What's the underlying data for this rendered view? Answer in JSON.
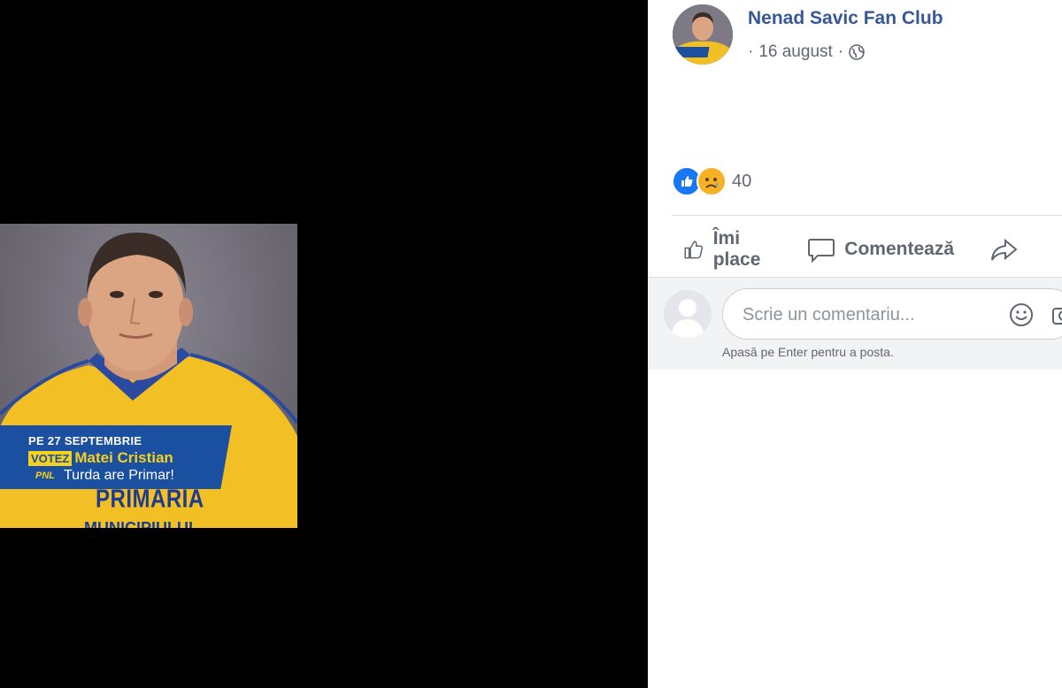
{
  "photo": {
    "banner_line1": "PE 27 SEPTEMBRIE",
    "banner_votez": "VOTEZ",
    "banner_name": "Matei Cristian",
    "banner_party": "PNL",
    "banner_line3": "Turda are Primar!",
    "shirt_text": "PRIMARIA",
    "shirt_text2": "MUNICIPIULUI"
  },
  "post": {
    "page_name": "Nenad Savic Fan Club",
    "date": "16 august",
    "audience_icon": "globe-icon",
    "reaction_count": "40",
    "reactions": [
      "like-reaction-icon",
      "sad-reaction-icon"
    ]
  },
  "actions": {
    "like_label": "Îmi place",
    "comment_label": "Comentează"
  },
  "comment": {
    "placeholder": "Scrie un comentariu...",
    "hint": "Apasă pe Enter pentru a posta."
  },
  "colors": {
    "link": "#365899",
    "like_blue": "#1877f2",
    "secondary_text": "#606770"
  }
}
